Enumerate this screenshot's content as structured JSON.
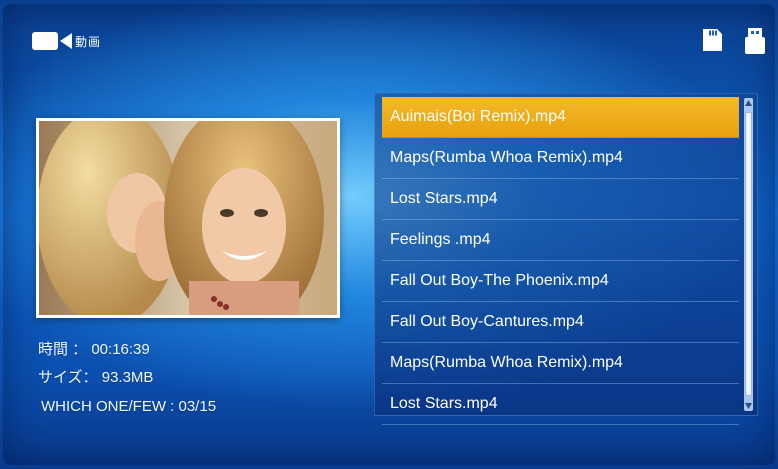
{
  "header": {
    "title": "動画",
    "icons": {
      "mode": "video-camera-icon",
      "storage1": "sd-card-icon",
      "storage2": "usb-drive-icon"
    }
  },
  "info": {
    "time_label": "時間  ：",
    "time_value": "00:16:39",
    "size_label": "サイズ：",
    "size_value": "93.3MB",
    "count_label": "WHICH ONE/FEW : ",
    "count_value": "03/15"
  },
  "playlist": {
    "items": [
      "Auimais(Boi Remix).mp4",
      "Maps(Rumba Whoa Remix).mp4",
      "Lost Stars.mp4",
      "Feelings .mp4",
      "Fall Out Boy-The Phoenix.mp4",
      "Fall Out Boy-Cantures.mp4",
      "Maps(Rumba Whoa Remix).mp4",
      "Lost Stars.mp4"
    ],
    "selected_index": 0
  },
  "colors": {
    "accent": "#f0ad1c",
    "background": "#0f63c6"
  }
}
